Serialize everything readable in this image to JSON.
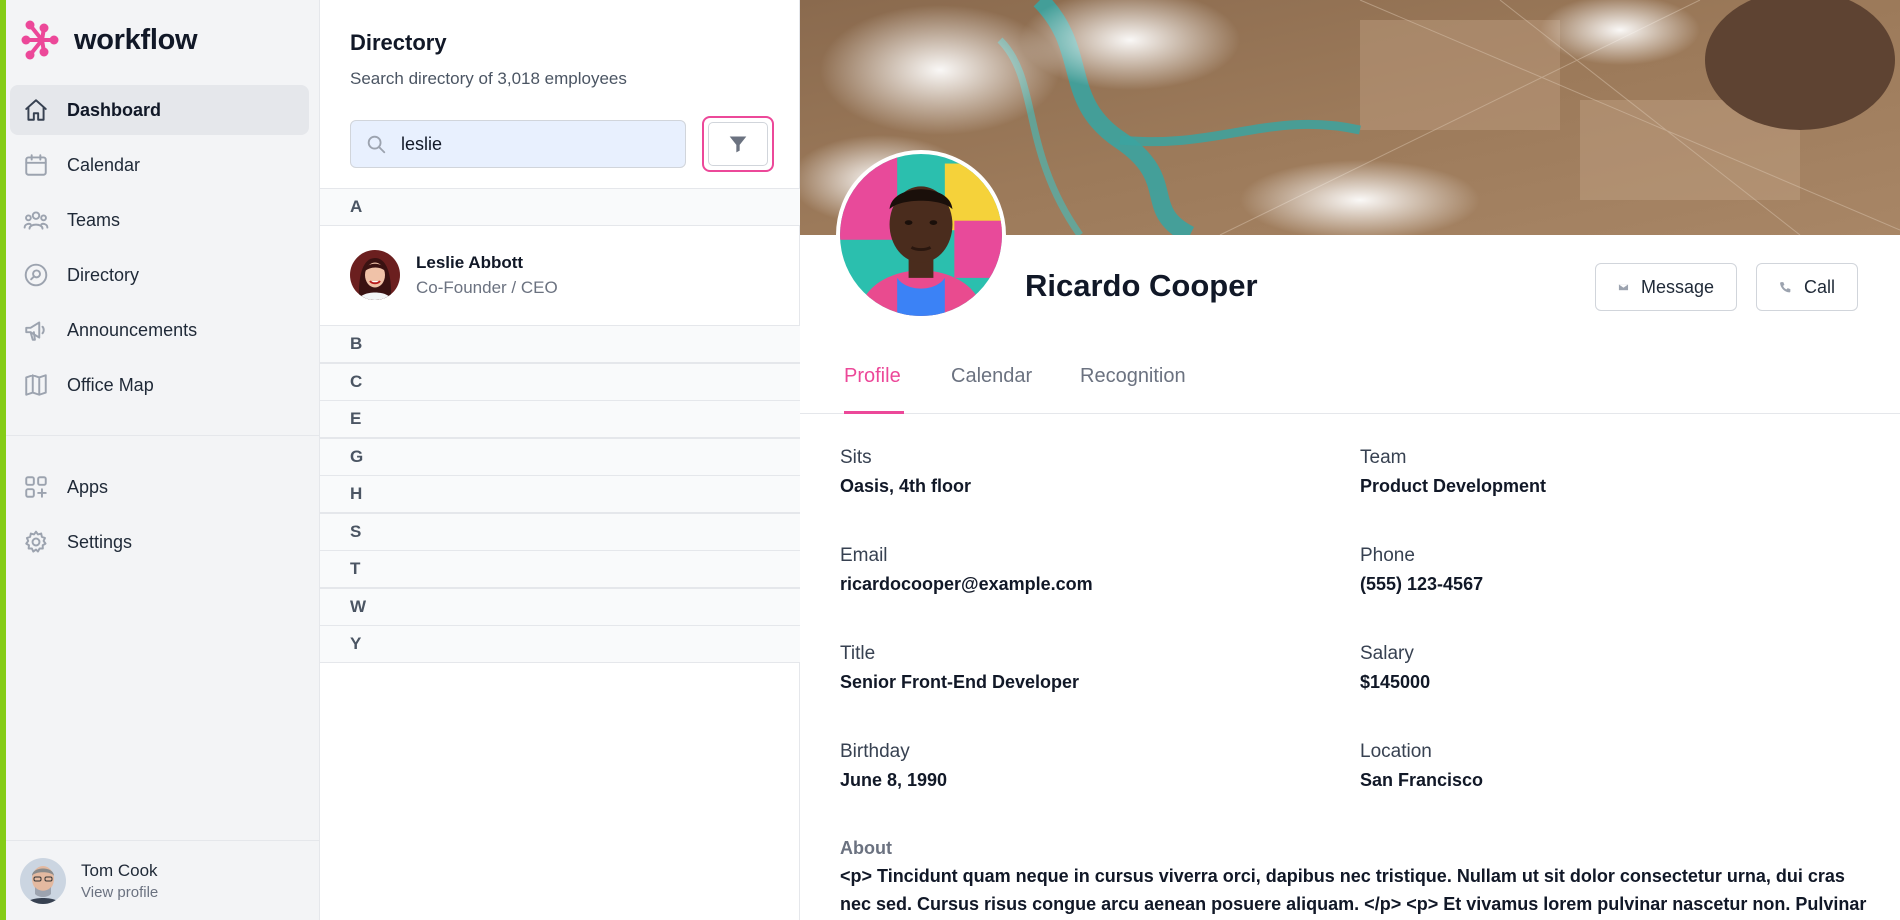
{
  "app": {
    "name": "workflow"
  },
  "sidebar": {
    "nav": [
      {
        "label": "Dashboard",
        "icon": "home-icon",
        "active": true
      },
      {
        "label": "Calendar",
        "icon": "calendar-icon"
      },
      {
        "label": "Teams",
        "icon": "users-icon"
      },
      {
        "label": "Directory",
        "icon": "search-circle-icon"
      },
      {
        "label": "Announcements",
        "icon": "megaphone-icon"
      },
      {
        "label": "Office Map",
        "icon": "map-icon"
      }
    ],
    "secondary": [
      {
        "label": "Apps",
        "icon": "apps-icon"
      },
      {
        "label": "Settings",
        "icon": "gear-icon"
      }
    ],
    "user": {
      "name": "Tom Cook",
      "link": "View profile"
    }
  },
  "directory": {
    "title": "Directory",
    "subtitle": "Search directory of 3,018 employees",
    "search": {
      "value": "leslie",
      "icon": "search-icon"
    },
    "filter_icon": "filter-icon",
    "groups": [
      {
        "letter": "A",
        "people": [
          {
            "name": "Leslie Abbott",
            "role": "Co-Founder / CEO"
          }
        ]
      },
      {
        "letter": "B"
      },
      {
        "letter": "C"
      },
      {
        "letter": "E"
      },
      {
        "letter": "G"
      },
      {
        "letter": "H"
      },
      {
        "letter": "S"
      },
      {
        "letter": "T"
      },
      {
        "letter": "W"
      },
      {
        "letter": "Y"
      }
    ]
  },
  "profile": {
    "name": "Ricardo Cooper",
    "actions": {
      "message": "Message",
      "call": "Call"
    },
    "tabs": [
      {
        "label": "Profile",
        "active": true
      },
      {
        "label": "Calendar"
      },
      {
        "label": "Recognition"
      }
    ],
    "fields": [
      {
        "label": "Sits",
        "value": "Oasis, 4th floor"
      },
      {
        "label": "Team",
        "value": "Product Development"
      },
      {
        "label": "Email",
        "value": "ricardocooper@example.com"
      },
      {
        "label": "Phone",
        "value": "(555) 123-4567"
      },
      {
        "label": "Title",
        "value": "Senior Front-End Developer"
      },
      {
        "label": "Salary",
        "value": "$145000"
      },
      {
        "label": "Birthday",
        "value": "June 8, 1990"
      },
      {
        "label": "Location",
        "value": "San Francisco"
      }
    ],
    "about": {
      "label": "About",
      "text": "<p> Tincidunt quam neque in cursus viverra orci, dapibus nec tristique. Nullam ut sit dolor consectetur urna, dui cras nec sed. Cursus risus congue arcu aenean posuere aliquam. </p> <p> Et vivamus lorem pulvinar nascetur non. Pulvinar"
    }
  },
  "colors": {
    "accent": "#ec4899",
    "sidebar_strip": "#84cc16",
    "search_bg": "#e8f0fe"
  }
}
